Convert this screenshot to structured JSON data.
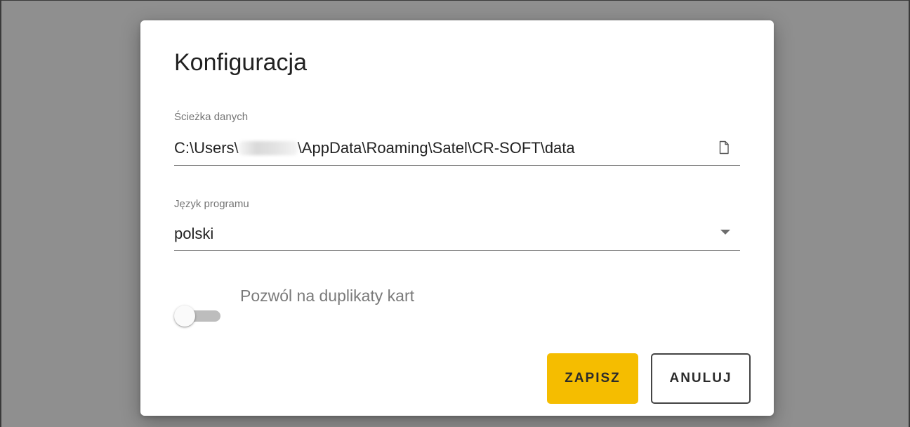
{
  "dialog": {
    "title": "Konfiguracja"
  },
  "data_path": {
    "label": "Ścieżka danych",
    "value_prefix": "C:\\Users\\",
    "value_suffix": "\\AppData\\Roaming\\Satel\\CR-SOFT\\data",
    "icon": "file-icon"
  },
  "language": {
    "label": "Język programu",
    "selected": "polski",
    "icon": "dropdown-arrow-icon"
  },
  "duplicates_toggle": {
    "label": "Pozwól na duplikaty kart",
    "checked": false
  },
  "buttons": {
    "save_label": "ZAPISZ",
    "cancel_label": "ANULUJ"
  },
  "colors": {
    "backdrop": "#8f8f8f",
    "dialog_bg": "#ffffff",
    "accent": "#f5bd00",
    "toggle_track": "#bdbdbd"
  }
}
